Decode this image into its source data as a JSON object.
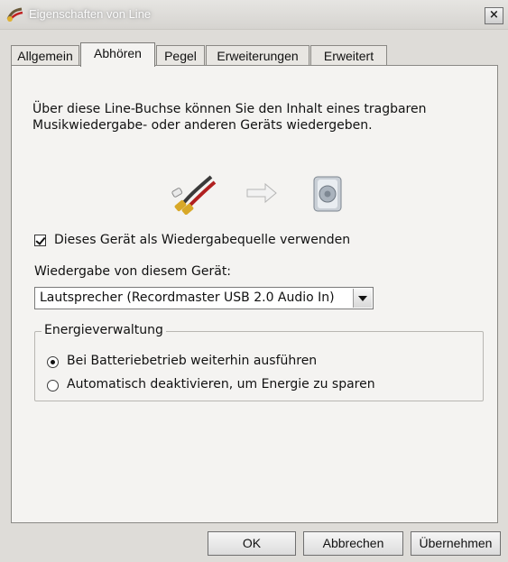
{
  "window": {
    "title": "Eigenschaften von Line",
    "close_label": "×"
  },
  "tabs": [
    {
      "label": "Allgemein",
      "active": false
    },
    {
      "label": "Abhören",
      "active": true
    },
    {
      "label": "Pegel",
      "active": false
    },
    {
      "label": "Erweiterungen",
      "active": false
    },
    {
      "label": "Erweitert",
      "active": false
    }
  ],
  "panel": {
    "description": "Über diese Line-Buchse können Sie den Inhalt eines tragbaren Musikwiedergabe- oder anderen Geräts wiedergeben.",
    "illustration_icons": [
      "audio-cable-icon",
      "arrow-right-icon",
      "speaker-icon"
    ],
    "use_as_source": {
      "label": "Dieses Gerät als Wiedergabequelle verwenden",
      "checked": true
    },
    "playback_label": "Wiedergabe von diesem Gerät:",
    "playback_device": {
      "selected": "Lautsprecher (Recordmaster USB 2.0 Audio In)"
    },
    "power": {
      "title": "Energieverwaltung",
      "options": [
        {
          "label": "Bei Batteriebetrieb weiterhin ausführen",
          "selected": true
        },
        {
          "label": "Automatisch deaktivieren, um Energie zu sparen",
          "selected": false
        }
      ]
    }
  },
  "buttons": {
    "ok": "OK",
    "cancel": "Abbrechen",
    "apply": "Übernehmen"
  },
  "colors": {
    "window_bg": "#dedcd8",
    "panel_bg": "#f4f3f1",
    "border": "#8a8985"
  }
}
